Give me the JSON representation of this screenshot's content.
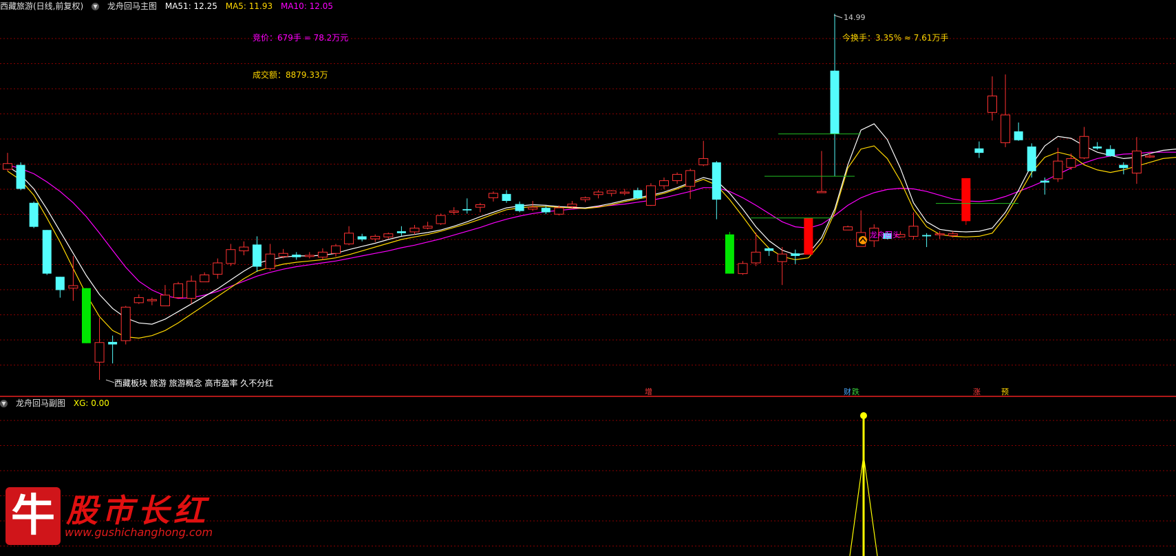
{
  "main_header": {
    "stock": "西藏旅游(日线,前复权)",
    "indicator": "龙舟回马主图",
    "ma51_label": "MA51: 12.25",
    "ma5_label": "MA5: 11.93",
    "ma10_label": "MA10: 12.05"
  },
  "sub_header": {
    "indicator": "龙舟回马副图",
    "xg_label": "XG: 0.00"
  },
  "annotations": {
    "bid": "竞价：679手 = 78.2万元",
    "turnover_amount": "成交额：8879.33万",
    "turnover_rate": "今换手：3.35% ≈ 7.61万手",
    "high_price": "14.99",
    "sector_info": "西藏板块 旅游 旅游概念 高市盈率 久不分红",
    "signal_label": "龙舟回头"
  },
  "event_markers": [
    {
      "label": "增",
      "color": "#ff3b3b"
    },
    {
      "label": "财",
      "color": "#4aa8ff"
    },
    {
      "label": "跌",
      "color": "#3ad13a"
    },
    {
      "label": "涨",
      "color": "#ff3b3b"
    },
    {
      "label": "预",
      "color": "#ffd400"
    }
  ],
  "colors": {
    "up": "#ff3232",
    "down": "#54fcfc",
    "limit_down": "#00e600",
    "limit_up": "#ff0000",
    "ma_white": "#ffffff",
    "ma_yellow": "#ffd700",
    "ma_magenta": "#ff00ff",
    "grid": "#8b0000",
    "xg_line": "#ffff00"
  },
  "logo": {
    "mark": "牛",
    "title": "股市长红",
    "url": "www.gushichanghong.com"
  },
  "chart_data": {
    "type": "candlestick",
    "y_top": 14.99,
    "candles": [
      {
        "o": 12.53,
        "c": 12.62,
        "h": 12.79,
        "l": 12.5,
        "k": "up"
      },
      {
        "o": 12.6,
        "c": 12.22,
        "h": 12.64,
        "l": 12.2,
        "k": "down"
      },
      {
        "o": 12.0,
        "c": 11.62,
        "h": 12.02,
        "l": 11.6,
        "k": "down"
      },
      {
        "o": 11.57,
        "c": 10.88,
        "h": 11.57,
        "l": 10.86,
        "k": "down"
      },
      {
        "o": 10.83,
        "c": 10.62,
        "h": 10.83,
        "l": 10.5,
        "k": "down"
      },
      {
        "o": 10.65,
        "c": 10.69,
        "h": 11.16,
        "l": 10.45,
        "k": "up"
      },
      {
        "o": 10.65,
        "c": 9.78,
        "h": 10.65,
        "l": 9.78,
        "k": "limit_down"
      },
      {
        "o": 9.48,
        "c": 9.79,
        "h": 10.18,
        "l": 9.2,
        "k": "up"
      },
      {
        "o": 9.8,
        "c": 9.76,
        "h": 9.9,
        "l": 9.46,
        "k": "down"
      },
      {
        "o": 9.82,
        "c": 10.35,
        "h": 10.37,
        "l": 9.76,
        "k": "up"
      },
      {
        "o": 10.42,
        "c": 10.5,
        "h": 10.55,
        "l": 10.4,
        "k": "up"
      },
      {
        "o": 10.45,
        "c": 10.47,
        "h": 10.5,
        "l": 10.38,
        "k": "up"
      },
      {
        "o": 10.37,
        "c": 10.54,
        "h": 10.7,
        "l": 10.37,
        "k": "up"
      },
      {
        "o": 10.5,
        "c": 10.72,
        "h": 10.75,
        "l": 10.48,
        "k": "up"
      },
      {
        "o": 10.49,
        "c": 10.76,
        "h": 10.85,
        "l": 10.4,
        "k": "up"
      },
      {
        "o": 10.75,
        "c": 10.86,
        "h": 10.9,
        "l": 10.75,
        "k": "up"
      },
      {
        "o": 10.87,
        "c": 11.05,
        "h": 11.12,
        "l": 10.8,
        "k": "up"
      },
      {
        "o": 11.04,
        "c": 11.26,
        "h": 11.35,
        "l": 11.0,
        "k": "up"
      },
      {
        "o": 11.24,
        "c": 11.3,
        "h": 11.39,
        "l": 11.17,
        "k": "up"
      },
      {
        "o": 11.34,
        "c": 10.99,
        "h": 11.47,
        "l": 10.91,
        "k": "down"
      },
      {
        "o": 10.96,
        "c": 11.19,
        "h": 11.35,
        "l": 10.93,
        "k": "up"
      },
      {
        "o": 11.15,
        "c": 11.2,
        "h": 11.27,
        "l": 11.12,
        "k": "up"
      },
      {
        "o": 11.18,
        "c": 11.14,
        "h": 11.22,
        "l": 11.1,
        "k": "down"
      },
      {
        "o": 11.15,
        "c": 11.17,
        "h": 11.22,
        "l": 11.12,
        "k": "up"
      },
      {
        "o": 11.14,
        "c": 11.22,
        "h": 11.28,
        "l": 11.1,
        "k": "up"
      },
      {
        "o": 11.2,
        "c": 11.32,
        "h": 11.35,
        "l": 11.15,
        "k": "up"
      },
      {
        "o": 11.35,
        "c": 11.52,
        "h": 11.63,
        "l": 11.33,
        "k": "up"
      },
      {
        "o": 11.47,
        "c": 11.42,
        "h": 11.51,
        "l": 11.39,
        "k": "down"
      },
      {
        "o": 11.43,
        "c": 11.47,
        "h": 11.5,
        "l": 11.38,
        "k": "up"
      },
      {
        "o": 11.46,
        "c": 11.51,
        "h": 11.53,
        "l": 11.43,
        "k": "up"
      },
      {
        "o": 11.55,
        "c": 11.52,
        "h": 11.63,
        "l": 11.48,
        "k": "down"
      },
      {
        "o": 11.54,
        "c": 11.6,
        "h": 11.65,
        "l": 11.5,
        "k": "up"
      },
      {
        "o": 11.6,
        "c": 11.63,
        "h": 11.7,
        "l": 11.58,
        "k": "up"
      },
      {
        "o": 11.67,
        "c": 11.8,
        "h": 11.83,
        "l": 11.65,
        "k": "up"
      },
      {
        "o": 11.85,
        "c": 11.87,
        "h": 11.93,
        "l": 11.81,
        "k": "up"
      },
      {
        "o": 11.9,
        "c": 11.88,
        "h": 12.07,
        "l": 11.83,
        "k": "down"
      },
      {
        "o": 11.93,
        "c": 11.97,
        "h": 12.0,
        "l": 11.85,
        "k": "up"
      },
      {
        "o": 12.08,
        "c": 12.15,
        "h": 12.18,
        "l": 12.02,
        "k": "up"
      },
      {
        "o": 12.14,
        "c": 12.03,
        "h": 12.2,
        "l": 12.0,
        "k": "down"
      },
      {
        "o": 11.98,
        "c": 11.87,
        "h": 12.02,
        "l": 11.85,
        "k": "down"
      },
      {
        "o": 11.9,
        "c": 11.93,
        "h": 12.03,
        "l": 11.87,
        "k": "up"
      },
      {
        "o": 11.92,
        "c": 11.85,
        "h": 11.95,
        "l": 11.82,
        "k": "down"
      },
      {
        "o": 11.82,
        "c": 11.92,
        "h": 11.96,
        "l": 11.8,
        "k": "up"
      },
      {
        "o": 11.94,
        "c": 11.98,
        "h": 12.03,
        "l": 11.92,
        "k": "up"
      },
      {
        "o": 12.05,
        "c": 12.08,
        "h": 12.1,
        "l": 12.01,
        "k": "up"
      },
      {
        "o": 12.13,
        "c": 12.17,
        "h": 12.2,
        "l": 12.07,
        "k": "up"
      },
      {
        "o": 12.15,
        "c": 12.19,
        "h": 12.2,
        "l": 12.1,
        "k": "up"
      },
      {
        "o": 12.17,
        "c": 12.15,
        "h": 12.22,
        "l": 12.12,
        "k": "up"
      },
      {
        "o": 12.2,
        "c": 12.07,
        "h": 12.24,
        "l": 12.06,
        "k": "down"
      },
      {
        "o": 11.96,
        "c": 12.27,
        "h": 12.31,
        "l": 11.95,
        "k": "up"
      },
      {
        "o": 12.27,
        "c": 12.35,
        "h": 12.4,
        "l": 12.22,
        "k": "up"
      },
      {
        "o": 12.35,
        "c": 12.45,
        "h": 12.48,
        "l": 12.3,
        "k": "up"
      },
      {
        "o": 12.26,
        "c": 12.51,
        "h": 12.54,
        "l": 12.06,
        "k": "up"
      },
      {
        "o": 12.6,
        "c": 12.7,
        "h": 12.98,
        "l": 12.58,
        "k": "up"
      },
      {
        "o": 12.64,
        "c": 12.05,
        "h": 12.66,
        "l": 11.74,
        "k": "down"
      },
      {
        "o": 11.5,
        "c": 10.88,
        "h": 11.54,
        "l": 10.88,
        "k": "limit_down"
      },
      {
        "o": 10.88,
        "c": 11.04,
        "h": 11.08,
        "l": 10.86,
        "k": "up"
      },
      {
        "o": 11.05,
        "c": 11.22,
        "h": 11.53,
        "l": 11.0,
        "k": "up"
      },
      {
        "o": 11.28,
        "c": 11.24,
        "h": 11.29,
        "l": 11.16,
        "k": "down"
      },
      {
        "o": 11.07,
        "c": 11.19,
        "h": 11.3,
        "l": 10.7,
        "k": "up"
      },
      {
        "o": 11.16,
        "c": 11.2,
        "h": 11.26,
        "l": 11.03,
        "k": "down"
      },
      {
        "o": 11.18,
        "c": 11.76,
        "h": 11.76,
        "l": 11.18,
        "k": "limit_up"
      },
      {
        "o": 12.16,
        "c": 12.18,
        "h": 12.82,
        "l": 12.17,
        "k": "up"
      },
      {
        "o": 14.09,
        "c": 13.09,
        "h": 14.99,
        "l": 12.42,
        "k": "down"
      },
      {
        "o": 11.57,
        "c": 11.62,
        "h": 11.64,
        "l": 11.6,
        "k": "up"
      },
      {
        "o": 11.53,
        "c": 11.31,
        "h": 11.88,
        "l": 11.31,
        "k": "up"
      },
      {
        "o": 11.6,
        "c": 11.4,
        "h": 11.66,
        "l": 11.3,
        "k": "up"
      },
      {
        "o": 11.52,
        "c": 11.43,
        "h": 11.55,
        "l": 11.42,
        "k": "down"
      },
      {
        "o": 11.46,
        "c": 11.5,
        "h": 11.55,
        "l": 11.45,
        "k": "up"
      },
      {
        "o": 11.47,
        "c": 11.63,
        "h": 11.85,
        "l": 11.42,
        "k": "up"
      },
      {
        "o": 11.49,
        "c": 11.47,
        "h": 11.52,
        "l": 11.3,
        "k": "down"
      },
      {
        "o": 11.5,
        "c": 11.51,
        "h": 11.55,
        "l": 11.43,
        "k": "up"
      },
      {
        "o": 11.48,
        "c": 11.51,
        "h": 11.55,
        "l": 11.45,
        "k": "up"
      },
      {
        "o": 11.71,
        "c": 12.39,
        "h": 12.39,
        "l": 11.65,
        "k": "limit_up"
      },
      {
        "o": 12.86,
        "c": 12.79,
        "h": 12.97,
        "l": 12.71,
        "k": "down"
      },
      {
        "o": 13.43,
        "c": 13.69,
        "h": 14.0,
        "l": 13.3,
        "k": "up"
      },
      {
        "o": 12.95,
        "c": 13.39,
        "h": 14.03,
        "l": 12.88,
        "k": "up"
      },
      {
        "o": 13.13,
        "c": 12.99,
        "h": 13.27,
        "l": 12.98,
        "k": "down"
      },
      {
        "o": 12.89,
        "c": 12.5,
        "h": 12.94,
        "l": 12.4,
        "k": "down"
      },
      {
        "o": 12.35,
        "c": 12.32,
        "h": 12.4,
        "l": 12.13,
        "k": "down"
      },
      {
        "o": 12.38,
        "c": 12.66,
        "h": 12.87,
        "l": 12.33,
        "k": "up"
      },
      {
        "o": 12.56,
        "c": 12.7,
        "h": 12.78,
        "l": 12.52,
        "k": "up"
      },
      {
        "o": 12.71,
        "c": 13.05,
        "h": 13.2,
        "l": 12.69,
        "k": "up"
      },
      {
        "o": 12.89,
        "c": 12.86,
        "h": 12.96,
        "l": 12.84,
        "k": "down"
      },
      {
        "o": 12.85,
        "c": 12.74,
        "h": 12.91,
        "l": 12.73,
        "k": "down"
      },
      {
        "o": 12.6,
        "c": 12.55,
        "h": 12.64,
        "l": 12.45,
        "k": "down"
      },
      {
        "o": 12.47,
        "c": 12.82,
        "h": 13.04,
        "l": 12.3,
        "k": "up"
      },
      {
        "o": 12.73,
        "c": 12.74,
        "h": 12.79,
        "l": 12.71,
        "k": "up"
      }
    ],
    "ma_white": [
      12.58,
      12.44,
      12.22,
      11.9,
      11.55,
      11.2,
      10.85,
      10.55,
      10.33,
      10.18,
      10.1,
      10.08,
      10.16,
      10.28,
      10.4,
      10.52,
      10.64,
      10.78,
      10.92,
      11.04,
      11.1,
      11.14,
      11.16,
      11.16,
      11.17,
      11.2,
      11.26,
      11.31,
      11.36,
      11.42,
      11.47,
      11.5,
      11.53,
      11.57,
      11.63,
      11.7,
      11.78,
      11.85,
      11.92,
      11.95,
      11.97,
      11.96,
      11.94,
      11.93,
      11.92,
      11.95,
      11.99,
      12.04,
      12.08,
      12.12,
      12.17,
      12.24,
      12.32,
      12.4,
      12.35,
      12.15,
      11.9,
      11.62,
      11.4,
      11.25,
      11.18,
      11.2,
      11.45,
      11.9,
      12.6,
      13.15,
      13.25,
      13.0,
      12.55,
      12.0,
      11.7,
      11.58,
      11.55,
      11.54,
      11.55,
      11.6,
      11.85,
      12.2,
      12.6,
      12.9,
      13.05,
      13.02,
      12.9,
      12.8,
      12.75,
      12.7,
      12.72,
      12.78,
      12.83,
      12.85
    ],
    "ma_yellow": [
      12.5,
      12.36,
      12.12,
      11.76,
      11.38,
      10.96,
      10.55,
      10.2,
      9.98,
      9.88,
      9.86,
      9.9,
      9.98,
      10.1,
      10.24,
      10.38,
      10.52,
      10.66,
      10.8,
      10.92,
      10.98,
      11.03,
      11.06,
      11.08,
      11.1,
      11.13,
      11.18,
      11.24,
      11.3,
      11.36,
      11.42,
      11.46,
      11.5,
      11.55,
      11.61,
      11.67,
      11.74,
      11.82,
      11.89,
      11.92,
      11.94,
      11.94,
      11.93,
      11.92,
      11.91,
      11.93,
      11.97,
      12.02,
      12.06,
      12.1,
      12.15,
      12.22,
      12.3,
      12.37,
      12.28,
      12.05,
      11.78,
      11.5,
      11.28,
      11.15,
      11.1,
      11.13,
      11.38,
      11.85,
      12.55,
      12.85,
      12.9,
      12.7,
      12.35,
      11.9,
      11.62,
      11.5,
      11.47,
      11.46,
      11.47,
      11.52,
      11.78,
      12.12,
      12.48,
      12.72,
      12.8,
      12.75,
      12.6,
      12.52,
      12.48,
      12.52,
      12.58,
      12.64,
      12.7,
      12.72
    ],
    "ma_magenta": [
      12.6,
      12.54,
      12.46,
      12.33,
      12.18,
      12.0,
      11.78,
      11.52,
      11.25,
      10.98,
      10.76,
      10.62,
      10.53,
      10.49,
      10.5,
      10.54,
      10.6,
      10.68,
      10.76,
      10.84,
      10.9,
      10.95,
      10.99,
      11.02,
      11.05,
      11.08,
      11.12,
      11.16,
      11.2,
      11.24,
      11.29,
      11.33,
      11.38,
      11.43,
      11.49,
      11.55,
      11.61,
      11.68,
      11.74,
      11.79,
      11.83,
      11.86,
      11.88,
      11.9,
      11.92,
      11.94,
      11.96,
      11.98,
      12.01,
      12.04,
      12.08,
      12.13,
      12.18,
      12.24,
      12.24,
      12.18,
      12.08,
      11.96,
      11.83,
      11.7,
      11.62,
      11.6,
      11.66,
      11.8,
      11.96,
      12.08,
      12.16,
      12.21,
      12.23,
      12.22,
      12.18,
      12.12,
      12.06,
      12.03,
      12.02,
      12.04,
      12.1,
      12.18,
      12.26,
      12.35,
      12.45,
      12.55,
      12.63,
      12.7,
      12.74,
      12.77,
      12.78,
      12.8,
      12.8,
      12.8
    ],
    "xg": {
      "label": "XG",
      "value": 0.0,
      "peak_value": 1
    }
  }
}
